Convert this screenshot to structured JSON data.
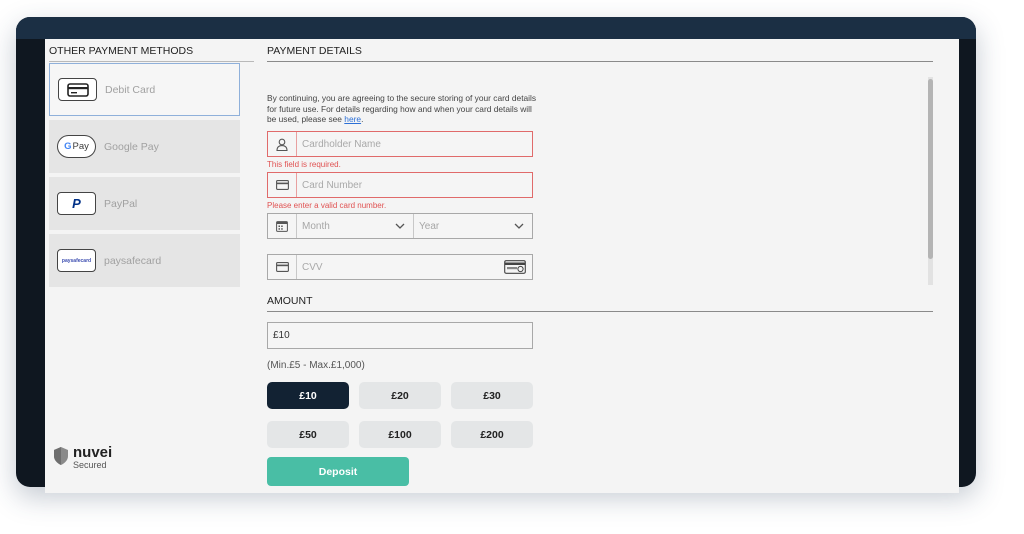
{
  "sidebar": {
    "heading": "OTHER PAYMENT METHODS",
    "methods": [
      {
        "label": "Debit Card",
        "icon": "credit-card-icon",
        "selected": true
      },
      {
        "label": "Google Pay",
        "icon": "google-pay-logo",
        "logo_text": "Pay",
        "logo_g": "G"
      },
      {
        "label": "PayPal",
        "icon": "paypal-logo",
        "logo_text": "P"
      },
      {
        "label": "paysafecard",
        "icon": "paysafecard-logo",
        "logo_text": "paysafecard"
      }
    ],
    "security": {
      "brand": "nuvei",
      "caption": "Secured"
    }
  },
  "payment": {
    "heading": "PAYMENT DETAILS",
    "consent_text": "By continuing, you are agreeing to the secure storing of your card details for future use. For details regarding how and when your card details will be used, please see ",
    "consent_link": "here",
    "consent_end": ".",
    "cardholder_placeholder": "Cardholder Name",
    "cardholder_error": "This field is required.",
    "card_number_placeholder": "Card Number",
    "card_number_error": "Please enter a valid card number.",
    "month_placeholder": "Month",
    "year_placeholder": "Year",
    "cvv_placeholder": "CVV"
  },
  "amount": {
    "heading": "AMOUNT",
    "value": "£10",
    "range_text": "(Min.£5 - Max.£1,000)",
    "presets": [
      "£10",
      "£20",
      "£30",
      "£50",
      "£100",
      "£200"
    ],
    "selected_preset": "£10",
    "deposit_label": "Deposit"
  },
  "colors": {
    "frame": "#0f1720",
    "frame_top": "#1b2f44",
    "error": "#e05252",
    "active_chip": "#122233",
    "deposit": "#49bea5",
    "link": "#2b6fd6"
  }
}
